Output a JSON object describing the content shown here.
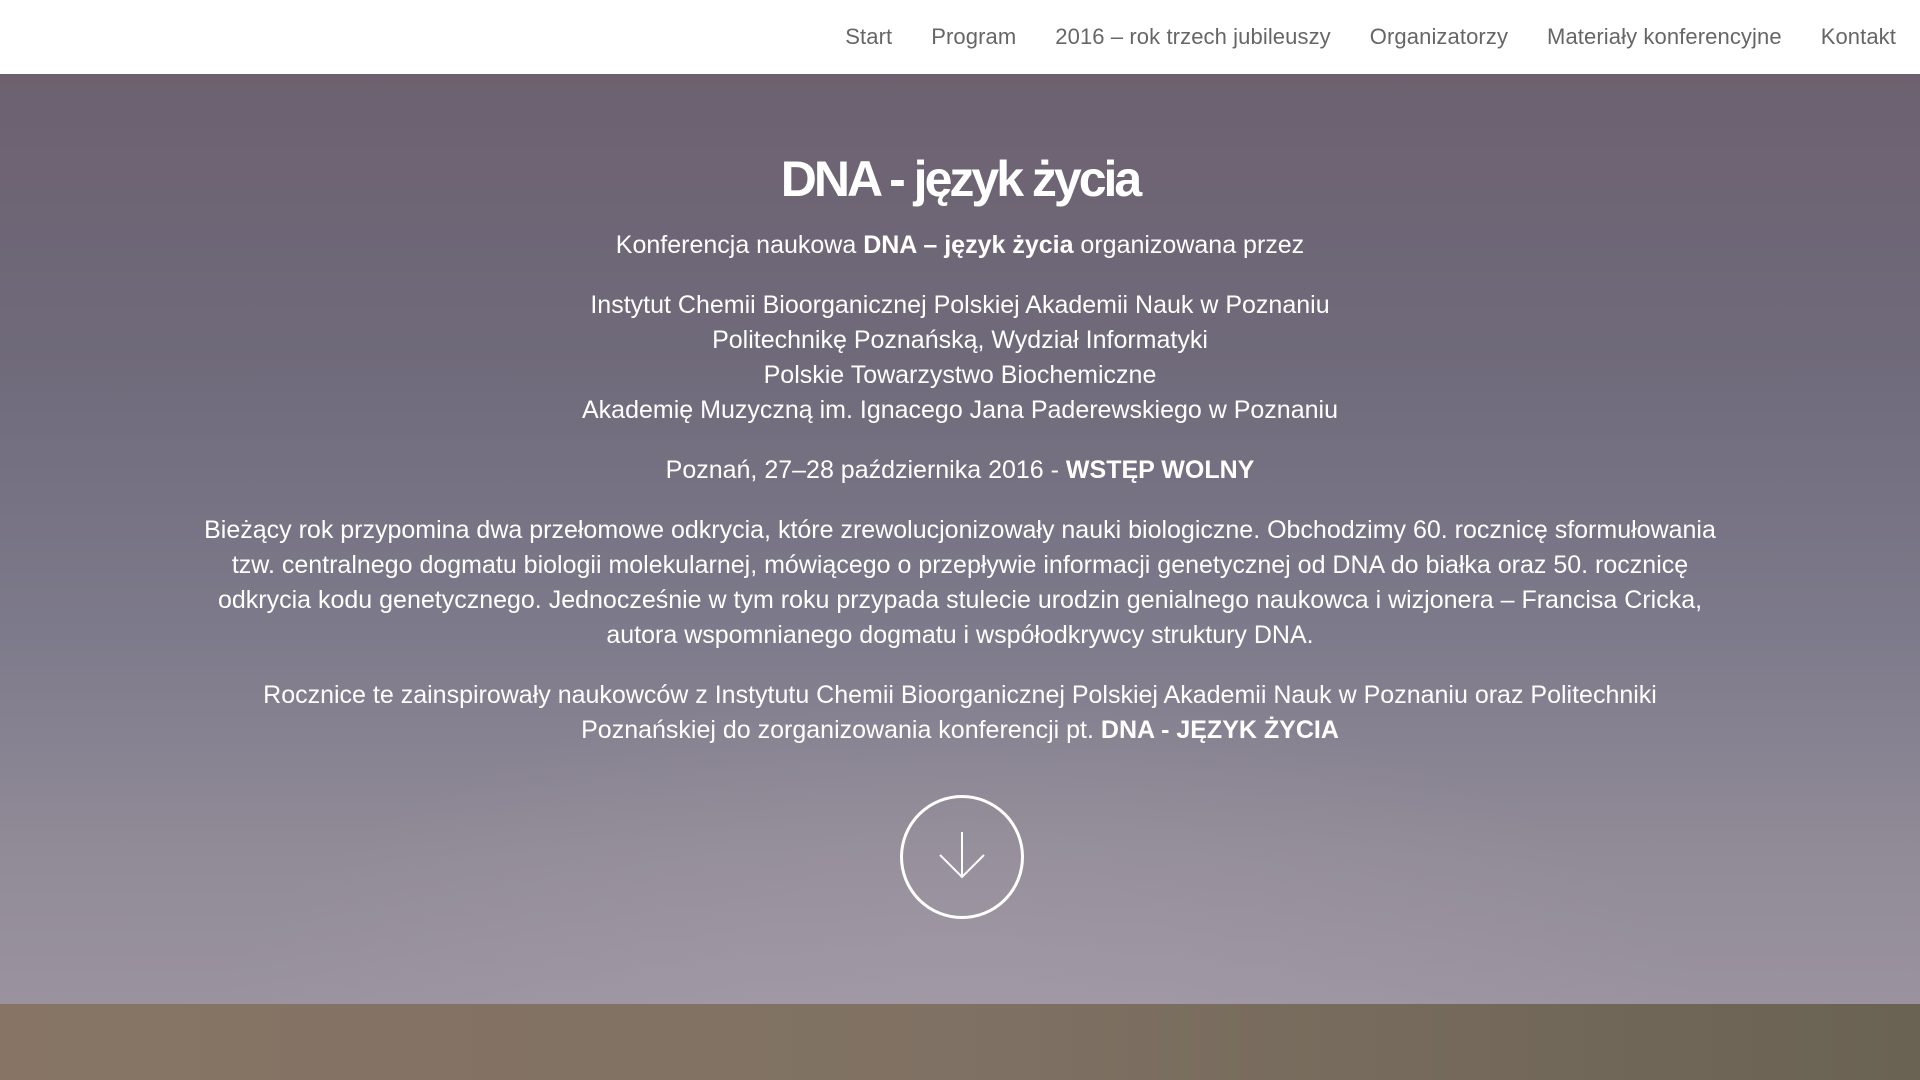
{
  "nav": {
    "items": [
      {
        "label": "Start"
      },
      {
        "label": "Program"
      },
      {
        "label": "2016 – rok trzech jubileuszy"
      },
      {
        "label": "Organizatorzy"
      },
      {
        "label": "Materiały konferencyjne"
      },
      {
        "label": "Kontakt"
      }
    ]
  },
  "hero": {
    "title": "DNA - język życia",
    "intro": {
      "before": "Konferencja naukowa ",
      "bold": "DNA – język życia",
      "after": " organizowana przez"
    },
    "organizers": [
      "Instytut Chemii Bioorganicznej Polskiej Akademii Nauk w Poznaniu",
      "Politechnikę Poznańską, Wydział Informatyki",
      "Polskie Towarzystwo Biochemiczne",
      "Akademię Muzyczną im. Ignacego Jana Paderewskiego w Poznaniu"
    ],
    "date": {
      "text": "Poznań, 27–28 października 2016 - ",
      "bold": "WSTĘP WOLNY"
    },
    "paragraph1": "Bieżący rok przypomina dwa przełomowe odkrycia, które zrewolucjonizowały nauki biologiczne. Obchodzimy 60. rocznicę sformułowania tzw. centralnego dogmatu biologii molekularnej, mówiącego o przepływie informacji genetycznej od DNA do białka oraz 50. rocznicę odkrycia kodu genetycznego. Jednocześnie w tym roku przypada stulecie urodzin genialnego naukowca i wizjonera – Francisa Cricka, autora wspomnianego dogmatu i współodkrywcy struktury DNA.",
    "paragraph2": {
      "text": "Rocznice te zainspirowały naukowców z Instytutu Chemii Bioorganicznej Polskiej Akademii Nauk w Poznaniu oraz Politechniki Poznańskiej do zorganizowania konferencji pt. ",
      "bold": "DNA - JĘZYK ŻYCIA"
    },
    "scroll_icon": "arrow-down-icon"
  },
  "colors": {
    "nav_text": "#666666",
    "hero_top": "#6d6170",
    "hero_bottom": "#9a939f",
    "next_section": "#7f7163"
  }
}
